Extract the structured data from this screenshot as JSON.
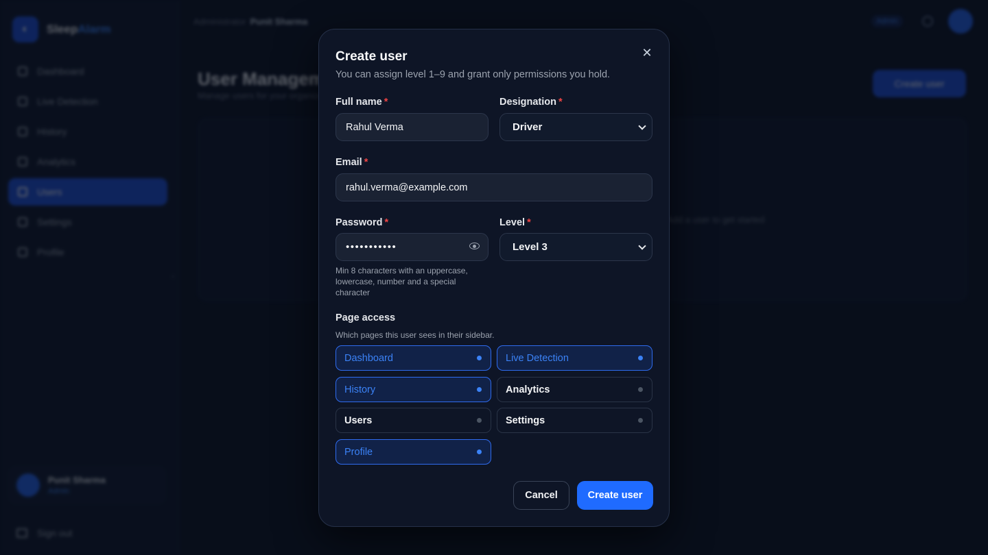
{
  "app": {
    "brand": {
      "name_a": "Sleep",
      "name_b": "Alarm"
    },
    "nav": [
      {
        "label": "Dashboard"
      },
      {
        "label": "Live Detection"
      },
      {
        "label": "History"
      },
      {
        "label": "Analytics"
      },
      {
        "label": "Users",
        "active": true
      },
      {
        "label": "Settings"
      },
      {
        "label": "Profile"
      }
    ],
    "user": {
      "name": "Punit Sharma",
      "role": "Admin"
    },
    "signout": "Sign out",
    "breadcrumb": {
      "parent": "Administrator",
      "current": "Punit Sharma"
    },
    "topbar_badge": "Admin",
    "page_title": "User Management",
    "page_subtitle": "Manage users for your organization",
    "create_button": "Create user",
    "empty_text": "Add a user to get started"
  },
  "modal": {
    "title": "Create user",
    "subtitle": "You can assign level 1–9 and grant only permissions you hold.",
    "full_name": {
      "label": "Full name",
      "value": "Rahul Verma"
    },
    "designation": {
      "label": "Designation",
      "value": "Driver"
    },
    "email": {
      "label": "Email",
      "value": "rahul.verma@example.com"
    },
    "password": {
      "label": "Password",
      "value": "•••••••••••",
      "hint": "Min 8 characters with an uppercase, lowercase, number and a special character"
    },
    "level": {
      "label": "Level",
      "value": "Level 3"
    },
    "page_access": {
      "title": "Page access",
      "subtitle": "Which pages this user sees in their sidebar.",
      "items": [
        {
          "label": "Dashboard",
          "on": true
        },
        {
          "label": "Live Detection",
          "on": true
        },
        {
          "label": "History",
          "on": true
        },
        {
          "label": "Analytics",
          "on": false
        },
        {
          "label": "Users",
          "on": false
        },
        {
          "label": "Settings",
          "on": false
        },
        {
          "label": "Profile",
          "on": true
        }
      ]
    },
    "cancel": "Cancel",
    "submit": "Create user",
    "required_mark": "*",
    "close_glyph": "✕"
  },
  "colors": {
    "accent": "#1f6bff",
    "required": "#ef4444",
    "background": "#0b1120"
  }
}
